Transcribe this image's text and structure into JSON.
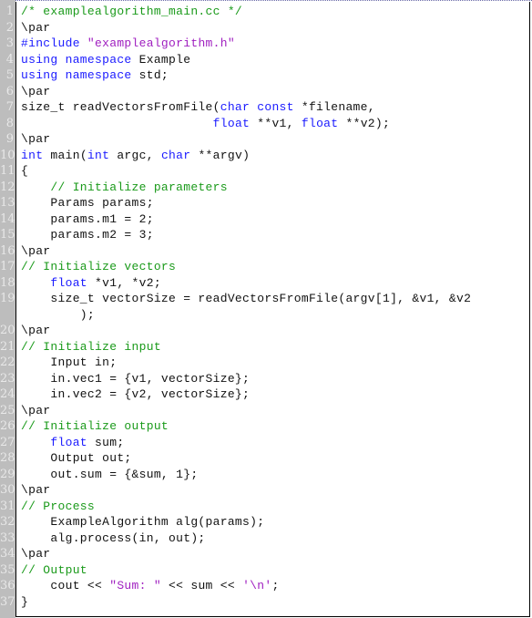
{
  "document": {
    "filename_comment": "/* examplealgorithm_main.cc */",
    "colors": {
      "keyword": "#1a1aff",
      "comment": "#1a9a1a",
      "string": "#a020c0",
      "text": "#111111",
      "gutter": "#bdbdbd"
    },
    "lines": [
      {
        "n": "1",
        "tokens": [
          {
            "t": "cm",
            "v": "/* examplealgorithm_main.cc */"
          }
        ]
      },
      {
        "n": "2",
        "tokens": [
          {
            "t": "tx",
            "v": "\\par"
          }
        ]
      },
      {
        "n": "3",
        "tokens": [
          {
            "t": "pp",
            "v": "#include "
          },
          {
            "t": "st",
            "v": "\"examplealgorithm.h\""
          }
        ]
      },
      {
        "n": "4",
        "tokens": [
          {
            "t": "kw",
            "v": "using namespace"
          },
          {
            "t": "tx",
            "v": " Example"
          }
        ]
      },
      {
        "n": "5",
        "tokens": [
          {
            "t": "kw",
            "v": "using namespace"
          },
          {
            "t": "tx",
            "v": " std;"
          }
        ]
      },
      {
        "n": "6",
        "tokens": [
          {
            "t": "tx",
            "v": "\\par"
          }
        ]
      },
      {
        "n": "7",
        "tokens": [
          {
            "t": "tx",
            "v": "size_t readVectorsFromFile("
          },
          {
            "t": "kw",
            "v": "char const"
          },
          {
            "t": "tx",
            "v": " *filename,"
          }
        ]
      },
      {
        "n": "8",
        "tokens": [
          {
            "t": "tx",
            "v": "                          "
          },
          {
            "t": "kw",
            "v": "float"
          },
          {
            "t": "tx",
            "v": " **v1, "
          },
          {
            "t": "kw",
            "v": "float"
          },
          {
            "t": "tx",
            "v": " **v2);"
          }
        ]
      },
      {
        "n": "9",
        "tokens": [
          {
            "t": "tx",
            "v": "\\par"
          }
        ]
      },
      {
        "n": "10",
        "tokens": [
          {
            "t": "kw",
            "v": "int"
          },
          {
            "t": "tx",
            "v": " main("
          },
          {
            "t": "kw",
            "v": "int"
          },
          {
            "t": "tx",
            "v": " argc, "
          },
          {
            "t": "kw",
            "v": "char"
          },
          {
            "t": "tx",
            "v": " **argv)"
          }
        ]
      },
      {
        "n": "11",
        "tokens": [
          {
            "t": "tx",
            "v": "{"
          }
        ]
      },
      {
        "n": "12",
        "tokens": [
          {
            "t": "tx",
            "v": "    "
          },
          {
            "t": "cm",
            "v": "// Initialize parameters"
          }
        ]
      },
      {
        "n": "13",
        "tokens": [
          {
            "t": "tx",
            "v": "    Params params;"
          }
        ]
      },
      {
        "n": "14",
        "tokens": [
          {
            "t": "tx",
            "v": "    params.m1 = 2;"
          }
        ]
      },
      {
        "n": "15",
        "tokens": [
          {
            "t": "tx",
            "v": "    params.m2 = 3;"
          }
        ]
      },
      {
        "n": "16",
        "tokens": [
          {
            "t": "tx",
            "v": "\\par"
          }
        ]
      },
      {
        "n": "17",
        "tokens": [
          {
            "t": "cm",
            "v": "// Initialize vectors"
          }
        ]
      },
      {
        "n": "18",
        "tokens": [
          {
            "t": "tx",
            "v": "    "
          },
          {
            "t": "kw",
            "v": "float"
          },
          {
            "t": "tx",
            "v": " *v1, *v2;"
          }
        ]
      },
      {
        "n": "19",
        "tokens": [
          {
            "t": "tx",
            "v": "    size_t vectorSize = readVectorsFromFile(argv[1], &v1, &v2"
          }
        ]
      },
      {
        "n": "",
        "tokens": [
          {
            "t": "tx",
            "v": "        );"
          }
        ]
      },
      {
        "n": "20",
        "tokens": [
          {
            "t": "tx",
            "v": "\\par"
          }
        ]
      },
      {
        "n": "21",
        "tokens": [
          {
            "t": "cm",
            "v": "// Initialize input"
          }
        ]
      },
      {
        "n": "22",
        "tokens": [
          {
            "t": "tx",
            "v": "    Input in;"
          }
        ]
      },
      {
        "n": "23",
        "tokens": [
          {
            "t": "tx",
            "v": "    in.vec1 = {v1, vectorSize};"
          }
        ]
      },
      {
        "n": "24",
        "tokens": [
          {
            "t": "tx",
            "v": "    in.vec2 = {v2, vectorSize};"
          }
        ]
      },
      {
        "n": "25",
        "tokens": [
          {
            "t": "tx",
            "v": "\\par"
          }
        ]
      },
      {
        "n": "26",
        "tokens": [
          {
            "t": "cm",
            "v": "// Initialize output"
          }
        ]
      },
      {
        "n": "27",
        "tokens": [
          {
            "t": "tx",
            "v": "    "
          },
          {
            "t": "kw",
            "v": "float"
          },
          {
            "t": "tx",
            "v": " sum;"
          }
        ]
      },
      {
        "n": "28",
        "tokens": [
          {
            "t": "tx",
            "v": "    Output out;"
          }
        ]
      },
      {
        "n": "29",
        "tokens": [
          {
            "t": "tx",
            "v": "    out.sum = {&sum, 1};"
          }
        ]
      },
      {
        "n": "30",
        "tokens": [
          {
            "t": "tx",
            "v": "\\par"
          }
        ]
      },
      {
        "n": "31",
        "tokens": [
          {
            "t": "cm",
            "v": "// Process"
          }
        ]
      },
      {
        "n": "32",
        "tokens": [
          {
            "t": "tx",
            "v": "    ExampleAlgorithm alg(params);"
          }
        ]
      },
      {
        "n": "33",
        "tokens": [
          {
            "t": "tx",
            "v": "    alg.process(in, out);"
          }
        ]
      },
      {
        "n": "34",
        "tokens": [
          {
            "t": "tx",
            "v": "\\par"
          }
        ]
      },
      {
        "n": "35",
        "tokens": [
          {
            "t": "cm",
            "v": "// Output"
          }
        ]
      },
      {
        "n": "36",
        "tokens": [
          {
            "t": "tx",
            "v": "    cout << "
          },
          {
            "t": "st",
            "v": "\"Sum: \""
          },
          {
            "t": "tx",
            "v": " << sum << "
          },
          {
            "t": "st",
            "v": "'\\n'"
          },
          {
            "t": "tx",
            "v": ";"
          }
        ]
      },
      {
        "n": "37",
        "tokens": [
          {
            "t": "tx",
            "v": "}"
          }
        ]
      }
    ]
  }
}
